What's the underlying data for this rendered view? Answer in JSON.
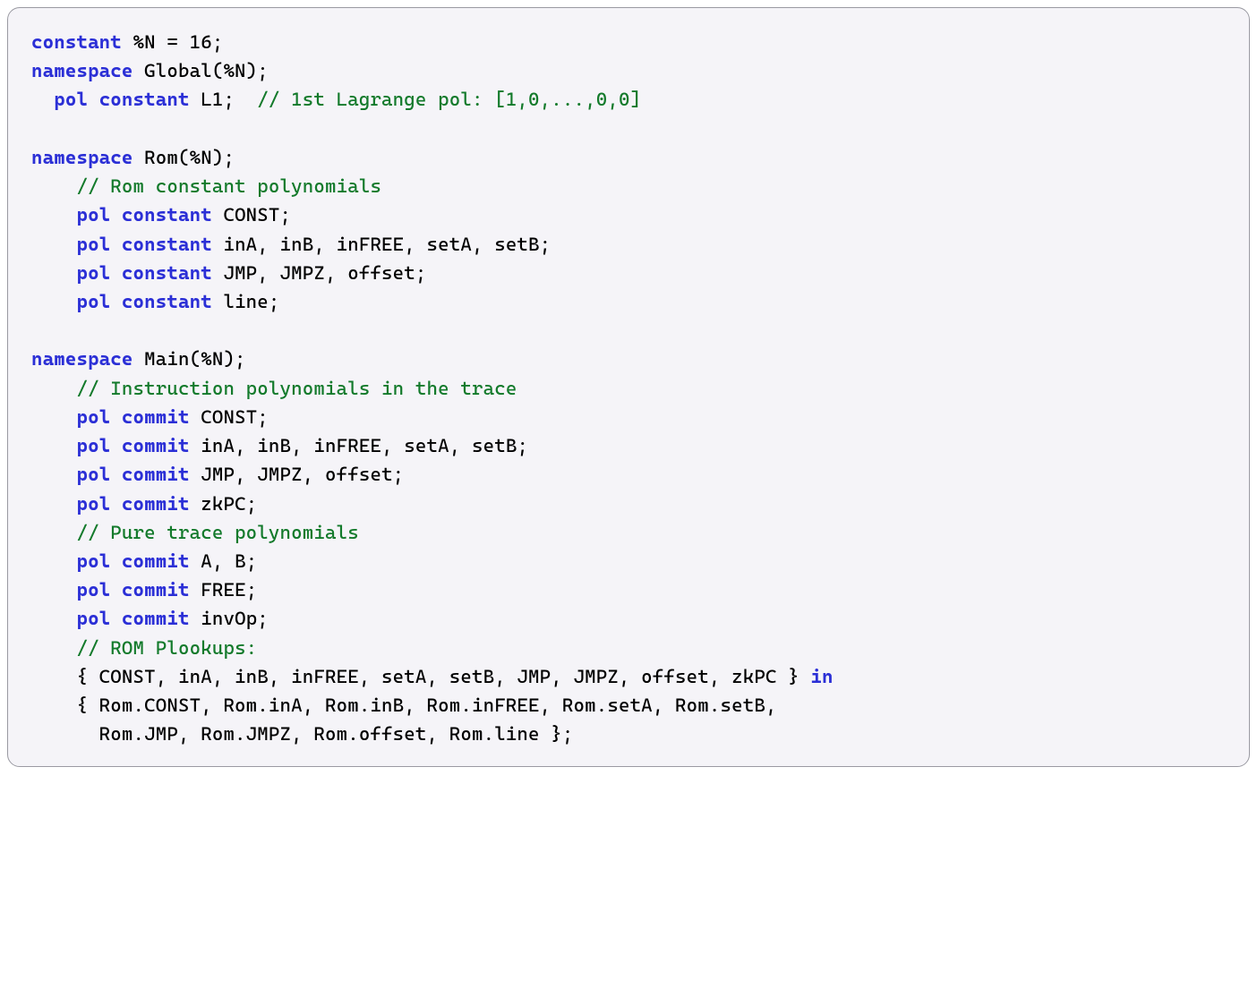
{
  "code": {
    "l1": [
      {
        "t": "kw",
        "v": "constant"
      },
      {
        "t": "tx",
        "v": " %N = 16;"
      }
    ],
    "l2": [
      {
        "t": "kw",
        "v": "namespace"
      },
      {
        "t": "tx",
        "v": " Global(%N);"
      }
    ],
    "l3": [
      {
        "t": "tx",
        "v": "  "
      },
      {
        "t": "kw",
        "v": "pol constant"
      },
      {
        "t": "tx",
        "v": " L1;  "
      },
      {
        "t": "cm",
        "v": "// 1st Lagrange pol: [1,0,...,0,0]"
      }
    ],
    "l4": [
      {
        "t": "tx",
        "v": ""
      }
    ],
    "l5": [
      {
        "t": "kw",
        "v": "namespace"
      },
      {
        "t": "tx",
        "v": " Rom(%N);"
      }
    ],
    "l6": [
      {
        "t": "tx",
        "v": "    "
      },
      {
        "t": "cm",
        "v": "// Rom constant polynomials"
      }
    ],
    "l7": [
      {
        "t": "tx",
        "v": "    "
      },
      {
        "t": "kw",
        "v": "pol constant"
      },
      {
        "t": "tx",
        "v": " CONST;"
      }
    ],
    "l8": [
      {
        "t": "tx",
        "v": "    "
      },
      {
        "t": "kw",
        "v": "pol constant"
      },
      {
        "t": "tx",
        "v": " inA, inB, inFREE, setA, setB;"
      }
    ],
    "l9": [
      {
        "t": "tx",
        "v": "    "
      },
      {
        "t": "kw",
        "v": "pol constant"
      },
      {
        "t": "tx",
        "v": " JMP, JMPZ, offset;"
      }
    ],
    "l10": [
      {
        "t": "tx",
        "v": "    "
      },
      {
        "t": "kw",
        "v": "pol constant"
      },
      {
        "t": "tx",
        "v": " line;"
      }
    ],
    "l11": [
      {
        "t": "tx",
        "v": ""
      }
    ],
    "l12": [
      {
        "t": "kw",
        "v": "namespace"
      },
      {
        "t": "tx",
        "v": " Main(%N);"
      }
    ],
    "l13": [
      {
        "t": "tx",
        "v": "    "
      },
      {
        "t": "cm",
        "v": "// Instruction polynomials in the trace"
      }
    ],
    "l14": [
      {
        "t": "tx",
        "v": "    "
      },
      {
        "t": "kw",
        "v": "pol commit"
      },
      {
        "t": "tx",
        "v": " CONST;"
      }
    ],
    "l15": [
      {
        "t": "tx",
        "v": "    "
      },
      {
        "t": "kw",
        "v": "pol commit"
      },
      {
        "t": "tx",
        "v": " inA, inB, inFREE, setA, setB;"
      }
    ],
    "l16": [
      {
        "t": "tx",
        "v": "    "
      },
      {
        "t": "kw",
        "v": "pol commit"
      },
      {
        "t": "tx",
        "v": " JMP, JMPZ, offset;"
      }
    ],
    "l17": [
      {
        "t": "tx",
        "v": "    "
      },
      {
        "t": "kw",
        "v": "pol commit"
      },
      {
        "t": "tx",
        "v": " zkPC;"
      }
    ],
    "l18": [
      {
        "t": "tx",
        "v": "    "
      },
      {
        "t": "cm",
        "v": "// Pure trace polynomials"
      }
    ],
    "l19": [
      {
        "t": "tx",
        "v": "    "
      },
      {
        "t": "kw",
        "v": "pol commit"
      },
      {
        "t": "tx",
        "v": " A, B;"
      }
    ],
    "l20": [
      {
        "t": "tx",
        "v": "    "
      },
      {
        "t": "kw",
        "v": "pol commit"
      },
      {
        "t": "tx",
        "v": " FREE;"
      }
    ],
    "l21": [
      {
        "t": "tx",
        "v": "    "
      },
      {
        "t": "kw",
        "v": "pol commit"
      },
      {
        "t": "tx",
        "v": " invOp;"
      }
    ],
    "l22": [
      {
        "t": "tx",
        "v": "    "
      },
      {
        "t": "cm",
        "v": "// ROM Plookups:"
      }
    ],
    "l23": [
      {
        "t": "tx",
        "v": "    { CONST, inA, inB, inFREE, setA, setB, JMP, JMPZ, offset, zkPC } "
      },
      {
        "t": "kw",
        "v": "in"
      }
    ],
    "l24": [
      {
        "t": "tx",
        "v": "    { Rom.CONST, Rom.inA, Rom.inB, Rom.inFREE, Rom.setA, Rom.setB,"
      }
    ],
    "l25": [
      {
        "t": "tx",
        "v": "      Rom.JMP, Rom.JMPZ, Rom.offset, Rom.line };"
      }
    ]
  }
}
